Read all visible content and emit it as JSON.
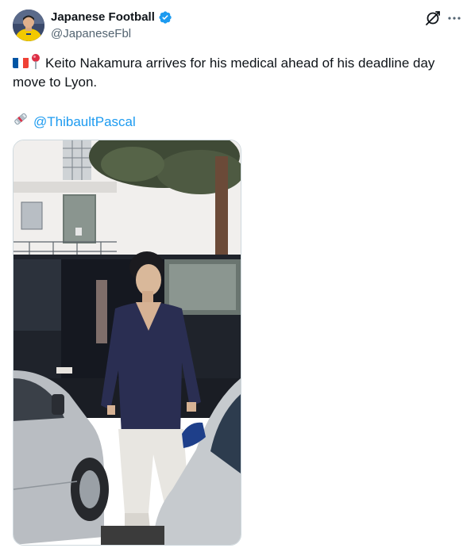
{
  "author": {
    "display_name": "Japanese Football",
    "handle": "@JapaneseFbl",
    "verified": true,
    "avatar_icon": "player-avatar-yellow-kit"
  },
  "tweet": {
    "text": "Keito Nakamura arrives for his medical ahead of his deadline day move to Lyon.",
    "emojis": [
      "france-flag",
      "round-pushpin"
    ],
    "credit_icon": "newspaper-roll-icon",
    "credit_handle": "@ThibaultPascal"
  },
  "actions": {
    "grok_icon": "grok-icon",
    "more_icon": "more-options-icon"
  },
  "colors": {
    "link": "#1d9bf0",
    "verified": "#1d9bf0",
    "secondary_text": "#536471",
    "primary_text": "#0f1419"
  }
}
